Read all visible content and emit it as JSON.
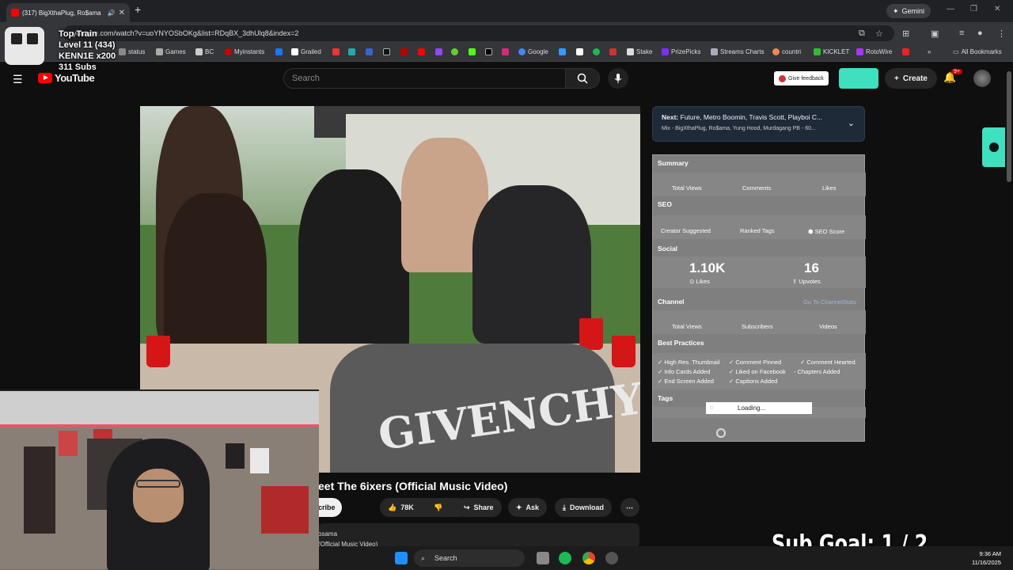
{
  "browser": {
    "tab_title": "(317) BigXthaPlug, Ro$ama",
    "url": "youtube.com/watch?v=uoYNYOSbOKg&list=RDqBX_3dhUlq8&index=2",
    "gemini_label": "Gemini",
    "bookmarks": [
      "status",
      "Games",
      "BC",
      "Myinstants",
      "Grailed",
      "Google",
      "Stake",
      "PrizePicks",
      "Streams Charts",
      "countri",
      "KICKLET",
      "RotoWire"
    ],
    "all_bookmarks": "All Bookmarks"
  },
  "stream_overlay": {
    "line1": "Top Train",
    "line2": "Level 11  (434)",
    "line3": "KENN1E x200",
    "line4": "311 Subs",
    "sub_goal": "Sub Goal:  1 / 2"
  },
  "youtube": {
    "logo": "YouTube",
    "search_placeholder": "Search",
    "give_feedback": "Give feedback",
    "create": "Create",
    "notifications_badge": "9+",
    "video_title": "eet The 6ixers (Official Music Video)",
    "subscribe_partial": "cribe",
    "likes": "78K",
    "share": "Share",
    "ask": "Ask",
    "download": "Download",
    "desc_line1": "osama",
    "desc_line2": "(Official Music Video)",
    "video_shirt_text": "GIVENCHY"
  },
  "next_card": {
    "label": "Next:",
    "title": "Future, Metro Boomin, Travis Scott, Playboi C...",
    "subtitle": "Mix - BigXthaPlug, Ro$ama, Yung Hood, Murdagang PB - 60..."
  },
  "analytics_panel": {
    "summary": "Summary",
    "total_views": "Total Views",
    "comments": "Comments",
    "likes": "Likes",
    "seo": "SEO",
    "creator_suggested": "Creator Suggested",
    "ranked_tags": "Ranked Tags",
    "seo_score": "SEO Score",
    "social": "Social",
    "likes_value": "1.10K",
    "likes_label": "Likes",
    "upvotes_value": "16",
    "upvotes_label": "Upvotes",
    "channel": "Channel",
    "go_to_channel": "Go To ChannelStats",
    "subscribers": "Subscribers",
    "videos": "Videos",
    "best_practices": "Best Practices",
    "bp1": "High Res. Thumbnail",
    "bp2": "Info Cards Added",
    "bp3": "End Screen Added",
    "bp4": "Comment Pinned",
    "bp5": "Liked on Facebook",
    "bp6": "Captions Added",
    "bp7": "Comment Hearted",
    "bp8": "Chapters Added",
    "tags": "Tags",
    "loading": "Loading..."
  },
  "taskbar": {
    "search": "Search",
    "time": "9:36 AM",
    "date": "11/16/2025"
  }
}
